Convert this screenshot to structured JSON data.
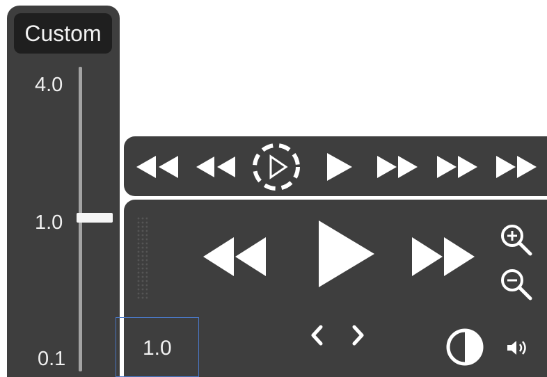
{
  "speed_panel": {
    "mode_label": "Custom",
    "ticks": {
      "max": "4.0",
      "mid": "1.0",
      "min": "0.1"
    },
    "current_speed": 1.0
  },
  "top_bar": {
    "icons": [
      "rewind-fast-icon",
      "rewind-icon",
      "loop-play-icon",
      "play-icon",
      "forward-icon",
      "forward-fast-icon",
      "forward-fastest-icon"
    ]
  },
  "main_panel": {
    "icons": [
      "rewind-icon",
      "play-icon",
      "fast-forward-icon",
      "zoom-in-icon",
      "zoom-out-icon",
      "chevron-left-icon",
      "chevron-right-icon",
      "contrast-icon",
      "speaker-icon"
    ]
  },
  "rate_value": "1.0"
}
